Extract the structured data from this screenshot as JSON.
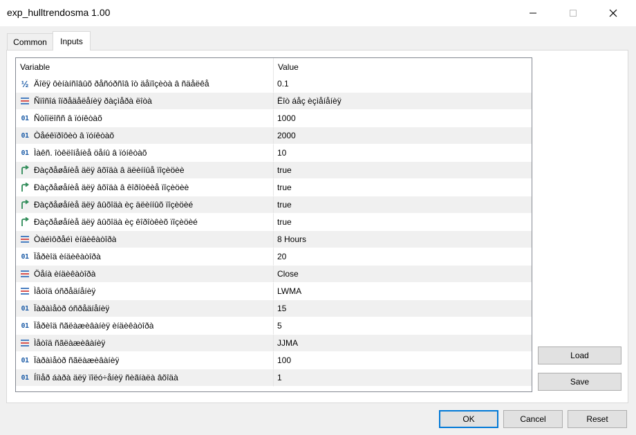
{
  "window": {
    "title": "exp_hulltrendosma 1.00"
  },
  "tabs": [
    {
      "label": "Common"
    },
    {
      "label": "Inputs"
    }
  ],
  "grid": {
    "headers": {
      "variable": "Variable",
      "value": "Value"
    },
    "rows": [
      {
        "icon": "fraction-icon",
        "variable": "Äîëÿ ôèíàíñîâûõ ðåñóðñîâ îò äåïîçèòà â ñäåëêå",
        "value": "0.1"
      },
      {
        "icon": "enum-icon",
        "variable": "Ñïîñîá îïðåäåëåíèÿ ðàçìåðà ëîòà",
        "value": "Ëîò áåç èçìåíåíèÿ"
      },
      {
        "icon": "integer-icon",
        "variable": "Ñòîïëîññ â ïóíêòàõ",
        "value": "1000"
      },
      {
        "icon": "integer-icon",
        "variable": "Òåéêïðîôèò â ïóíêòàõ",
        "value": "2000"
      },
      {
        "icon": "integer-icon",
        "variable": "Ìàêñ. îòêëîíåíèå öåíû â ïóíêòàõ",
        "value": "10"
      },
      {
        "icon": "bool-icon",
        "variable": "Ðàçðåøåíèå äëÿ âõîäà â äëèííûå ïîçèöèè",
        "value": "true"
      },
      {
        "icon": "bool-icon",
        "variable": "Ðàçðåøåíèå äëÿ âõîäà â êîðîòêèå ïîçèöèè",
        "value": "true"
      },
      {
        "icon": "bool-icon",
        "variable": "Ðàçðåøåíèå äëÿ âûõîäà èç äëèííûõ ïîçèöèé",
        "value": "true"
      },
      {
        "icon": "bool-icon",
        "variable": "Ðàçðåøåíèå äëÿ âûõîäà èç êîðîòêèõ ïîçèöèé",
        "value": "true"
      },
      {
        "icon": "enum-icon",
        "variable": "Òàéìôðåéì èíäèêàòîðà",
        "value": "8 Hours"
      },
      {
        "icon": "integer-icon",
        "variable": "Ïåðèîä èíäèêàòîðà",
        "value": "20"
      },
      {
        "icon": "enum-icon",
        "variable": "Öåíà èíäèêàòîðà",
        "value": "Close"
      },
      {
        "icon": "enum-icon",
        "variable": "Ìåòîä óñðåäíåíèÿ",
        "value": "LWMA"
      },
      {
        "icon": "integer-icon",
        "variable": "Ïàðàìåòð óñðåäíåíèÿ",
        "value": "15"
      },
      {
        "icon": "integer-icon",
        "variable": "Ïåðèîä ñãëàæèâàíèÿ èíäèêàòîðà",
        "value": "5"
      },
      {
        "icon": "enum-icon",
        "variable": "Ìåòîä ñãëàæèâàíèÿ",
        "value": "JJMA"
      },
      {
        "icon": "integer-icon",
        "variable": "Ïàðàìåòð ñãëàæèâàíèÿ",
        "value": "100"
      },
      {
        "icon": "integer-icon",
        "variable": "Íîìåð áàðà äëÿ ïîëó÷åíèÿ ñèãíàëà âõîäà",
        "value": "1"
      }
    ]
  },
  "side_buttons": {
    "load": "Load",
    "save": "Save"
  },
  "footer_buttons": {
    "ok": "OK",
    "cancel": "Cancel",
    "reset": "Reset"
  },
  "colors": {
    "accent": "#0078d7",
    "row_shade": "#f0f0f0",
    "icon_blue": "#1f5ea8",
    "bool_green": "#2e8b57"
  }
}
